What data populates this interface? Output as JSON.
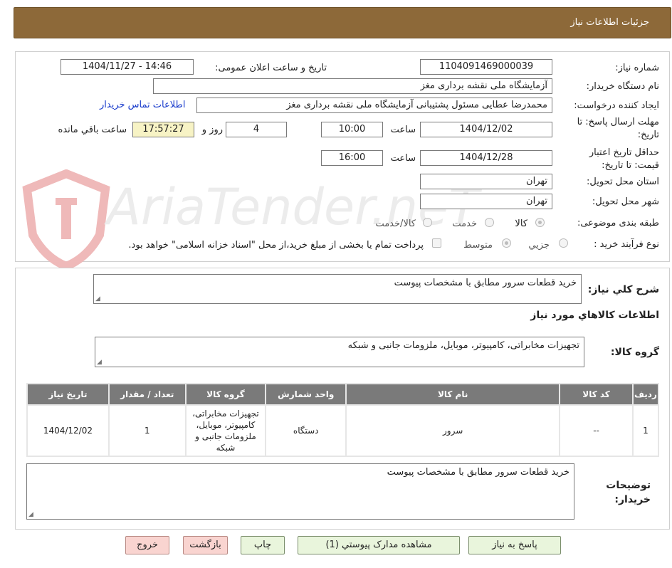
{
  "header": {
    "title": "جزئیات اطلاعات نیاز"
  },
  "form": {
    "need_number_label": "شماره نیاز:",
    "need_number_value": "1104091469000039",
    "announce_label": "تاریخ و ساعت اعلان عمومی:",
    "announce_value": "1404/11/27 - 14:46",
    "buyer_org_label": "نام دستگاه خریدار:",
    "buyer_org_value": "آزمایشگاه ملی نقشه برداری مغز",
    "requester_label": "ایجاد کننده درخواست:",
    "requester_value": "محمدرضا عطایی مسئول پشتیبانی آزمایشگاه ملی نقشه برداری مغز",
    "contact_link": "اطلاعات تماس خریدار",
    "deadline_label": "مهلت ارسال پاسخ: تا تاریخ:",
    "deadline_date": "1404/12/02",
    "time_label": "ساعت",
    "deadline_time": "10:00",
    "days_value": "4",
    "days_label": "روز و",
    "remaining_time": "17:57:27",
    "remaining_label": "ساعت باقي مانده",
    "validity_label": "حداقل تاریخ اعتبار قیمت: تا تاریخ:",
    "validity_date": "1404/12/28",
    "validity_time": "16:00",
    "province_label": "استان محل تحویل:",
    "province_value": "تهران",
    "city_label": "شهر محل تحویل:",
    "city_value": "تهران",
    "category_label": "طبقه بندی موضوعی:",
    "category_options": [
      "کالا",
      "خدمت",
      "کالا/خدمت"
    ],
    "category_selected": "کالا",
    "process_label": "نوع فرآیند خرید :",
    "process_options": [
      "جزیي",
      "متوسط"
    ],
    "process_selected": "متوسط",
    "treasury_note": "پرداخت تمام یا بخشی از مبلغ خرید،از محل \"اسناد خزانه اسلامی\" خواهد بود."
  },
  "summary": {
    "label": "شرح کلي نیاز:",
    "value": "خرید قطعات سرور مطابق با مشخصات پیوست",
    "goods_info_title": "اطلاعات کالاهاي مورد نیاز",
    "group_label": "گروه کالا:",
    "group_value": "تجهیزات مخابراتی، کامپیوتر، موبایل، ملزومات جانبی و شبکه"
  },
  "table": {
    "headers": [
      "ردیف",
      "کد کالا",
      "نام کالا",
      "واحد شمارش",
      "گروه کالا",
      "تعداد / مقدار",
      "تاریخ نیاز"
    ],
    "rows": [
      [
        "1",
        "--",
        "سرور",
        "دستگاه",
        "تجهیزات مخابراتی، کامپیوتر، موبایل، ملزومات جانبی و شبکه",
        "1",
        "1404/12/02"
      ]
    ]
  },
  "notes": {
    "label": "توضیحات خریدار:",
    "value": "خرید قطعات سرور مطابق با مشخصات پیوست"
  },
  "buttons": {
    "respond": "پاسخ به نیاز",
    "attachments": "مشاهده مدارک پیوستي (1)",
    "print": "چاپ",
    "back": "بازگشت",
    "exit": "خروج"
  },
  "watermark": "AriaTender.neT",
  "colors": {
    "header": "#8d6939",
    "table_header": "#7a7a7a",
    "button": "#e9f5dc",
    "button_red": "#f9d4d0",
    "link": "#1a3ccc"
  }
}
